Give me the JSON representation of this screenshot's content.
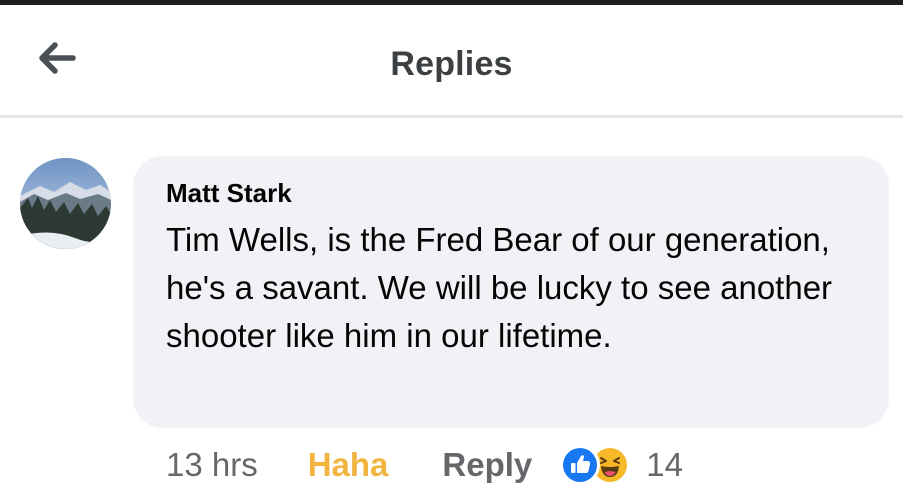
{
  "header": {
    "title": "Replies",
    "back_icon": "arrow-left-icon"
  },
  "comment": {
    "author": "Matt Stark",
    "text": "Tim Wells, is the Fred Bear of our generation, he's a savant. We will be lucky to see another shooter like him in our lifetime.",
    "time": "13 hrs",
    "reaction_label": "Haha",
    "reply_label": "Reply",
    "reaction_icons": [
      "like-icon",
      "haha-icon"
    ],
    "reaction_count": "14"
  },
  "colors": {
    "haha_accent": "#f0b43f",
    "like_blue": "#1877f2",
    "bubble_bg": "#f0f2f5",
    "secondary_text": "#65676b"
  }
}
